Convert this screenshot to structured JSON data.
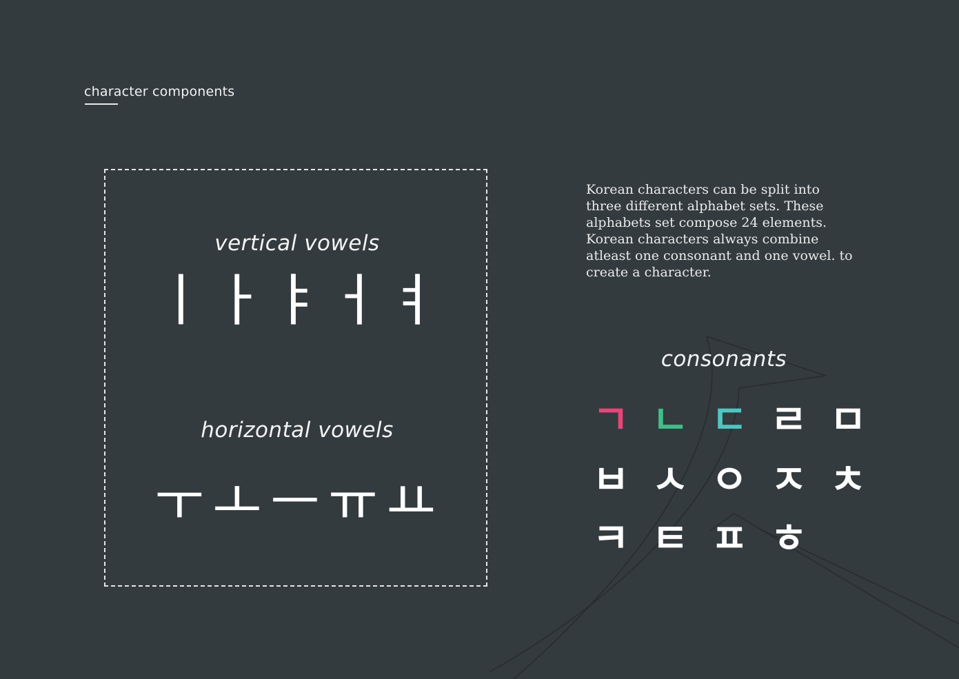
{
  "heading": "character components",
  "vertical_vowels": {
    "label": "vertical vowels",
    "glyphs": [
      "ㅣ",
      "ㅏ",
      "ㅑ",
      "ㅓ",
      "ㅕ"
    ]
  },
  "horizontal_vowels": {
    "label": "horizontal vowels",
    "glyphs": [
      "ㅜ",
      "ㅗ",
      "ㅡ",
      "ㅠ",
      "ㅛ"
    ]
  },
  "description": "Korean characters can be split into three different alphabet sets. These alphabets set compose 24 elements. Korean characters always combine atleast one consonant and one vowel. to create a character.",
  "consonants": {
    "label": "consonants",
    "rows": [
      [
        "ㄱ",
        "ㄴ",
        "ㄷ",
        "ㄹ",
        "ㅁ"
      ],
      [
        "ㅂ",
        "ㅅ",
        "ㅇ",
        "ㅈ",
        "ㅊ"
      ],
      [
        "ㅋ",
        "ㅌ",
        "ㅍ",
        "ㅎ"
      ]
    ],
    "highlight_colors": [
      "#e8457a",
      "#3fbf88",
      "#4fc6c0"
    ]
  },
  "colors": {
    "background": "#343b3f",
    "text": "#ffffff",
    "watermark_stroke": "#262b2e"
  }
}
